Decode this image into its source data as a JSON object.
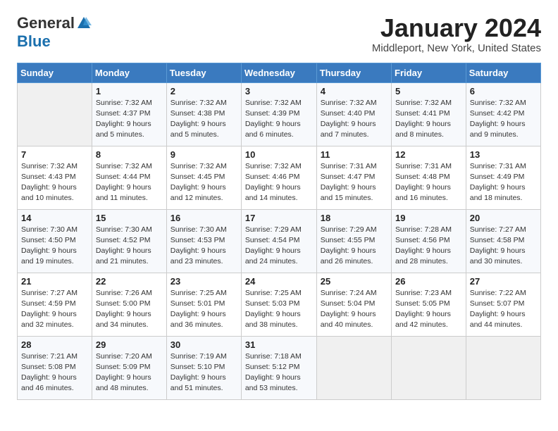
{
  "header": {
    "logo_general": "General",
    "logo_blue": "Blue",
    "month_title": "January 2024",
    "location": "Middleport, New York, United States"
  },
  "days_of_week": [
    "Sunday",
    "Monday",
    "Tuesday",
    "Wednesday",
    "Thursday",
    "Friday",
    "Saturday"
  ],
  "weeks": [
    [
      {
        "day": "",
        "info": ""
      },
      {
        "day": "1",
        "info": "Sunrise: 7:32 AM\nSunset: 4:37 PM\nDaylight: 9 hours\nand 5 minutes."
      },
      {
        "day": "2",
        "info": "Sunrise: 7:32 AM\nSunset: 4:38 PM\nDaylight: 9 hours\nand 5 minutes."
      },
      {
        "day": "3",
        "info": "Sunrise: 7:32 AM\nSunset: 4:39 PM\nDaylight: 9 hours\nand 6 minutes."
      },
      {
        "day": "4",
        "info": "Sunrise: 7:32 AM\nSunset: 4:40 PM\nDaylight: 9 hours\nand 7 minutes."
      },
      {
        "day": "5",
        "info": "Sunrise: 7:32 AM\nSunset: 4:41 PM\nDaylight: 9 hours\nand 8 minutes."
      },
      {
        "day": "6",
        "info": "Sunrise: 7:32 AM\nSunset: 4:42 PM\nDaylight: 9 hours\nand 9 minutes."
      }
    ],
    [
      {
        "day": "7",
        "info": "Sunrise: 7:32 AM\nSunset: 4:43 PM\nDaylight: 9 hours\nand 10 minutes."
      },
      {
        "day": "8",
        "info": "Sunrise: 7:32 AM\nSunset: 4:44 PM\nDaylight: 9 hours\nand 11 minutes."
      },
      {
        "day": "9",
        "info": "Sunrise: 7:32 AM\nSunset: 4:45 PM\nDaylight: 9 hours\nand 12 minutes."
      },
      {
        "day": "10",
        "info": "Sunrise: 7:32 AM\nSunset: 4:46 PM\nDaylight: 9 hours\nand 14 minutes."
      },
      {
        "day": "11",
        "info": "Sunrise: 7:31 AM\nSunset: 4:47 PM\nDaylight: 9 hours\nand 15 minutes."
      },
      {
        "day": "12",
        "info": "Sunrise: 7:31 AM\nSunset: 4:48 PM\nDaylight: 9 hours\nand 16 minutes."
      },
      {
        "day": "13",
        "info": "Sunrise: 7:31 AM\nSunset: 4:49 PM\nDaylight: 9 hours\nand 18 minutes."
      }
    ],
    [
      {
        "day": "14",
        "info": "Sunrise: 7:30 AM\nSunset: 4:50 PM\nDaylight: 9 hours\nand 19 minutes."
      },
      {
        "day": "15",
        "info": "Sunrise: 7:30 AM\nSunset: 4:52 PM\nDaylight: 9 hours\nand 21 minutes."
      },
      {
        "day": "16",
        "info": "Sunrise: 7:30 AM\nSunset: 4:53 PM\nDaylight: 9 hours\nand 23 minutes."
      },
      {
        "day": "17",
        "info": "Sunrise: 7:29 AM\nSunset: 4:54 PM\nDaylight: 9 hours\nand 24 minutes."
      },
      {
        "day": "18",
        "info": "Sunrise: 7:29 AM\nSunset: 4:55 PM\nDaylight: 9 hours\nand 26 minutes."
      },
      {
        "day": "19",
        "info": "Sunrise: 7:28 AM\nSunset: 4:56 PM\nDaylight: 9 hours\nand 28 minutes."
      },
      {
        "day": "20",
        "info": "Sunrise: 7:27 AM\nSunset: 4:58 PM\nDaylight: 9 hours\nand 30 minutes."
      }
    ],
    [
      {
        "day": "21",
        "info": "Sunrise: 7:27 AM\nSunset: 4:59 PM\nDaylight: 9 hours\nand 32 minutes."
      },
      {
        "day": "22",
        "info": "Sunrise: 7:26 AM\nSunset: 5:00 PM\nDaylight: 9 hours\nand 34 minutes."
      },
      {
        "day": "23",
        "info": "Sunrise: 7:25 AM\nSunset: 5:01 PM\nDaylight: 9 hours\nand 36 minutes."
      },
      {
        "day": "24",
        "info": "Sunrise: 7:25 AM\nSunset: 5:03 PM\nDaylight: 9 hours\nand 38 minutes."
      },
      {
        "day": "25",
        "info": "Sunrise: 7:24 AM\nSunset: 5:04 PM\nDaylight: 9 hours\nand 40 minutes."
      },
      {
        "day": "26",
        "info": "Sunrise: 7:23 AM\nSunset: 5:05 PM\nDaylight: 9 hours\nand 42 minutes."
      },
      {
        "day": "27",
        "info": "Sunrise: 7:22 AM\nSunset: 5:07 PM\nDaylight: 9 hours\nand 44 minutes."
      }
    ],
    [
      {
        "day": "28",
        "info": "Sunrise: 7:21 AM\nSunset: 5:08 PM\nDaylight: 9 hours\nand 46 minutes."
      },
      {
        "day": "29",
        "info": "Sunrise: 7:20 AM\nSunset: 5:09 PM\nDaylight: 9 hours\nand 48 minutes."
      },
      {
        "day": "30",
        "info": "Sunrise: 7:19 AM\nSunset: 5:10 PM\nDaylight: 9 hours\nand 51 minutes."
      },
      {
        "day": "31",
        "info": "Sunrise: 7:18 AM\nSunset: 5:12 PM\nDaylight: 9 hours\nand 53 minutes."
      },
      {
        "day": "",
        "info": ""
      },
      {
        "day": "",
        "info": ""
      },
      {
        "day": "",
        "info": ""
      }
    ]
  ]
}
